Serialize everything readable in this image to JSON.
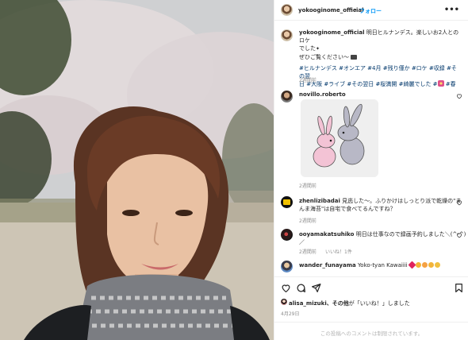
{
  "post": {
    "owner": "yokooginome_official",
    "follow_label": "フォロー",
    "more_label": "•••",
    "caption_user": "yokooginome_official",
    "caption_text_1": " 明日ヒルナンデス。楽しいお2人とのロケ",
    "caption_text_2": "でした",
    "caption_text_3": "ぜひご覧ください〜",
    "hashtags_1": "#ヒルナンデス #オンエア #4月 #残り僅か #ロケ #収録 #その翌",
    "hashtags_2": "日 #大阪 #ライブ #その翌日 #桜満開 #綺麗でした #",
    "hashtags_3": " #春",
    "caption_time": "2週間前"
  },
  "comments": [
    {
      "user": "novillo.roberto",
      "text": "",
      "time": "2週間前"
    },
    {
      "user": "zhenlizibadai",
      "text_1": " 見逃した〜。ふりかけはしっとり派で乾燥の\"ま",
      "text_2": "んま海苔\"は自宅で食べてるんですね？",
      "time": "2週間前"
    },
    {
      "user": "ooyamakatsuhiko",
      "text_1": " 明日は仕事なので録画予約しました＼(^-^)",
      "text_2": "／",
      "time": "2週間前",
      "likes": "いいね！1件"
    },
    {
      "user": "wander_funayama",
      "text": " Yoko-tyan Kawaiiii ",
      "time": "2週間前"
    }
  ],
  "footer": {
    "liked_by_user": "alisa_mizuki",
    "liked_by_text": "、その他",
    "liked_by_suffix": "が「いいね！」しました",
    "date": "4月29日",
    "comment_disabled": "この投稿へのコメントは制限されています。"
  },
  "colors": {
    "link": "#0095f6",
    "hashtag": "#00376b",
    "muted": "#8e8e8e"
  }
}
